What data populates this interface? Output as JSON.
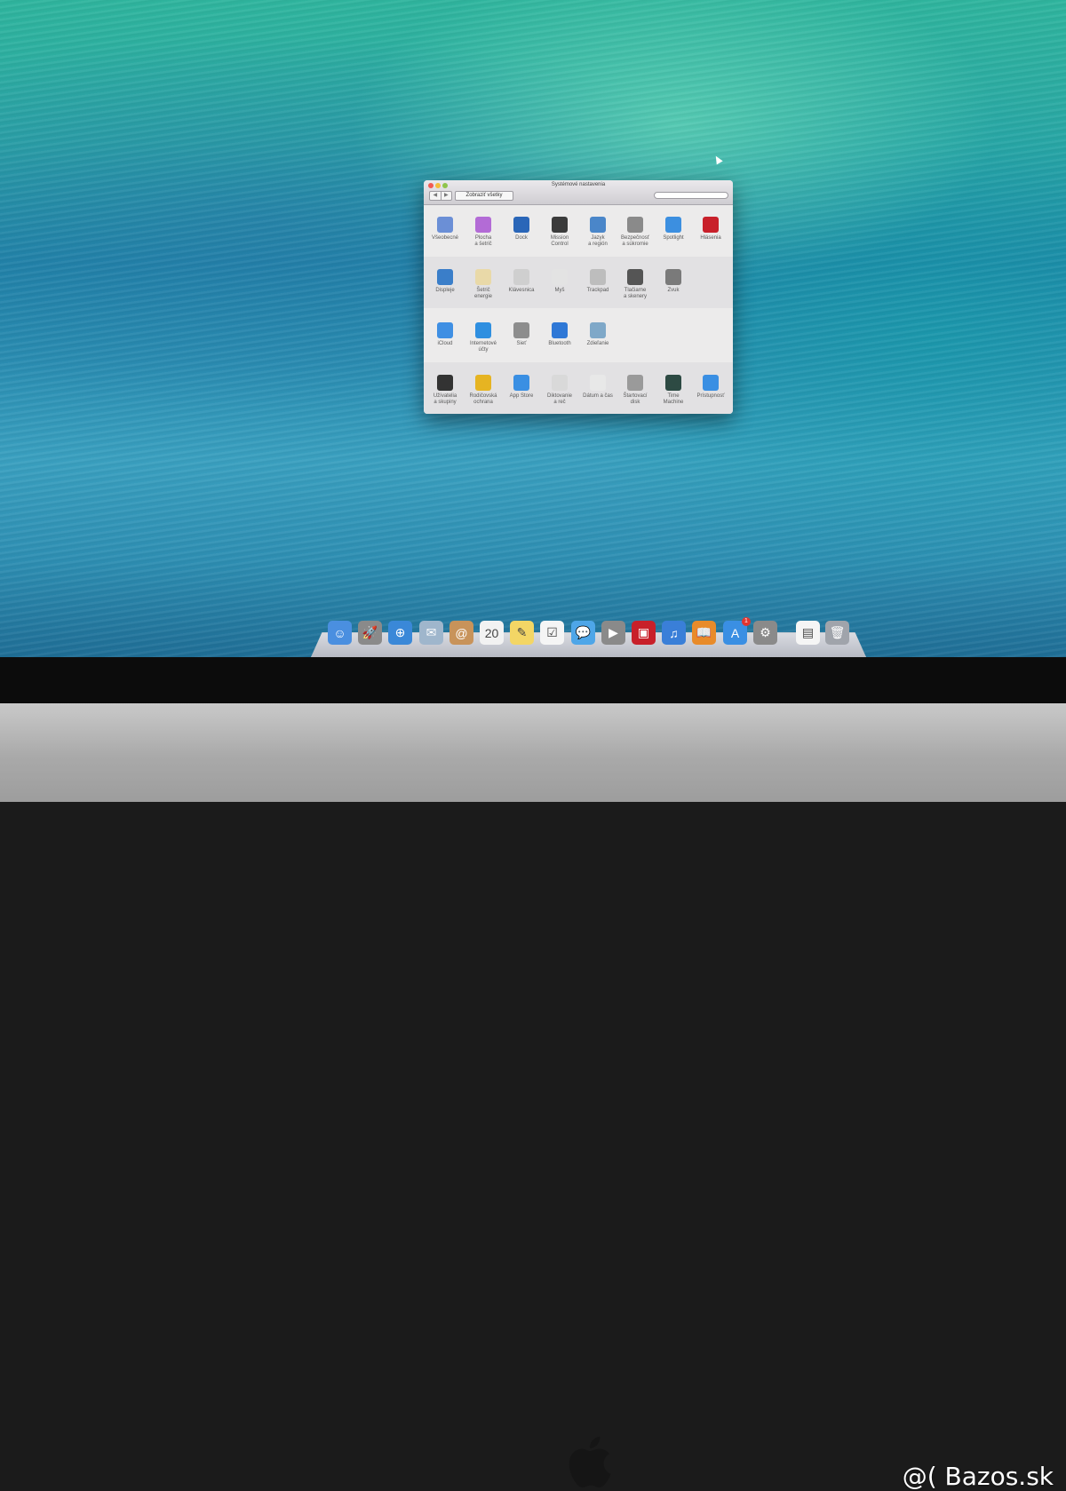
{
  "window": {
    "title": "Systémové nastavenia",
    "nav_back": "◀",
    "nav_forward": "▶",
    "show_all": "Zobraziť všetky",
    "search_placeholder": "",
    "sections": [
      [
        {
          "label": "Všeobecné",
          "icon": "general-icon",
          "color": "#6b8fd6"
        },
        {
          "label": "Plocha\na šetrič",
          "icon": "desktop-screensaver-icon",
          "color": "#b36bd6"
        },
        {
          "label": "Dock",
          "icon": "dock-icon",
          "color": "#2a66b8"
        },
        {
          "label": "Mission\nControl",
          "icon": "mission-control-icon",
          "color": "#3b3b3b"
        },
        {
          "label": "Jazyk\na región",
          "icon": "language-region-icon",
          "color": "#4a86c9"
        },
        {
          "label": "Bezpečnosť\na súkromie",
          "icon": "security-privacy-icon",
          "color": "#8a8a8a"
        },
        {
          "label": "Spotlight",
          "icon": "spotlight-icon",
          "color": "#3c8fe0"
        },
        {
          "label": "Hlásenia",
          "icon": "notifications-icon",
          "color": "#c8202a"
        }
      ],
      [
        {
          "label": "Displeje",
          "icon": "displays-icon",
          "color": "#3a7ec9"
        },
        {
          "label": "Šetrič\nenergie",
          "icon": "energy-saver-icon",
          "color": "#e9d9a8"
        },
        {
          "label": "Klávesnica",
          "icon": "keyboard-icon",
          "color": "#cfcfcf"
        },
        {
          "label": "Myš",
          "icon": "mouse-icon",
          "color": "#e3e3e3"
        },
        {
          "label": "Trackpad",
          "icon": "trackpad-icon",
          "color": "#bdbdbd"
        },
        {
          "label": "Tlačiarne\na skenery",
          "icon": "printer-icon",
          "color": "#555555"
        },
        {
          "label": "Zvuk",
          "icon": "sound-icon",
          "color": "#7a7a7a"
        }
      ],
      [
        {
          "label": "iCloud",
          "icon": "icloud-icon",
          "color": "#3f8fe3"
        },
        {
          "label": "Internetové\núčty",
          "icon": "internet-accounts-icon",
          "color": "#2f8fe0"
        },
        {
          "label": "Sieť",
          "icon": "network-icon",
          "color": "#8d8d8d"
        },
        {
          "label": "Bluetooth",
          "icon": "bluetooth-icon",
          "color": "#2f78d6"
        },
        {
          "label": "Zdieľanie",
          "icon": "sharing-icon",
          "color": "#7fa8c8"
        }
      ],
      [
        {
          "label": "Užívatelia\na skupiny",
          "icon": "users-groups-icon",
          "color": "#333333"
        },
        {
          "label": "Rodičovská\nochrana",
          "icon": "parental-controls-icon",
          "color": "#e6b422"
        },
        {
          "label": "App Store",
          "icon": "app-store-icon",
          "color": "#3a8fe3"
        },
        {
          "label": "Diktovanie\na reč",
          "icon": "dictation-icon",
          "color": "#d9d9d9"
        },
        {
          "label": "Dátum a čas",
          "icon": "date-time-icon",
          "color": "#e8e8e8"
        },
        {
          "label": "Štartovací\ndisk",
          "icon": "startup-disk-icon",
          "color": "#9a9a9a"
        },
        {
          "label": "Time\nMachine",
          "icon": "time-machine-icon",
          "color": "#2d4a43"
        },
        {
          "label": "Prístupnosť",
          "icon": "accessibility-icon",
          "color": "#3a8fe3"
        }
      ]
    ]
  },
  "dock": {
    "items": [
      {
        "name": "finder",
        "color": "#4a8fe0",
        "glyph": "☺"
      },
      {
        "name": "launchpad",
        "color": "#8a8a8a",
        "glyph": "🚀"
      },
      {
        "name": "safari",
        "color": "#3a88d8",
        "glyph": "⊕"
      },
      {
        "name": "mail",
        "color": "#9fb6cc",
        "glyph": "✉"
      },
      {
        "name": "contacts",
        "color": "#c8935a",
        "glyph": "@"
      },
      {
        "name": "calendar",
        "color": "#f2f2f2",
        "glyph": "20"
      },
      {
        "name": "notes",
        "color": "#f3d665",
        "glyph": "✎"
      },
      {
        "name": "reminders",
        "color": "#f5f5f5",
        "glyph": "☑"
      },
      {
        "name": "messages",
        "color": "#4ea6e8",
        "glyph": "💬"
      },
      {
        "name": "facetime",
        "color": "#8a8a8a",
        "glyph": "▶"
      },
      {
        "name": "photo-booth",
        "color": "#c8202a",
        "glyph": "▣"
      },
      {
        "name": "itunes",
        "color": "#3a7fd8",
        "glyph": "♫"
      },
      {
        "name": "ibooks",
        "color": "#e88b2a",
        "glyph": "📖"
      },
      {
        "name": "app-store",
        "color": "#3a8fe3",
        "glyph": "A"
      },
      {
        "name": "system-preferences",
        "color": "#8a8a8a",
        "glyph": "⚙"
      },
      {
        "name": "document",
        "color": "#f5f5f5",
        "glyph": "▤"
      },
      {
        "name": "trash",
        "color": "#a0a4ab",
        "glyph": "🗑"
      }
    ],
    "badge": "1"
  },
  "watermark": "@( Bazos.sk"
}
